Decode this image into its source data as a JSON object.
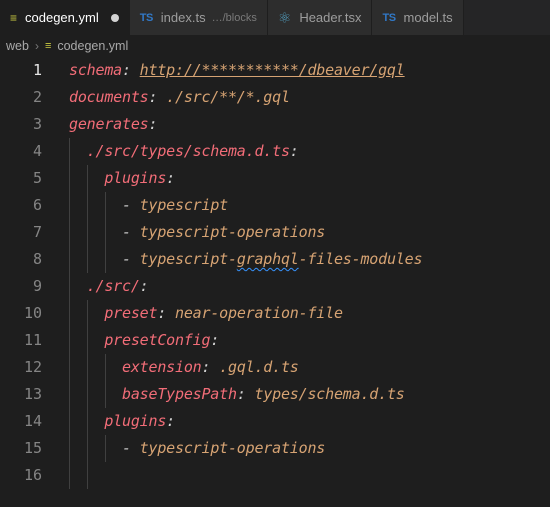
{
  "tabs": [
    {
      "label": "codegen.yml",
      "icon": "yaml-file-icon",
      "dirty": true,
      "active": true
    },
    {
      "label": "index.ts",
      "description": "…/blocks",
      "icon": "typescript-file-icon"
    },
    {
      "label": "Header.tsx",
      "icon": "react-file-icon"
    },
    {
      "label": "model.ts",
      "icon": "typescript-file-icon"
    }
  ],
  "icons": {
    "ts_glyph": "TS",
    "yml_glyph": "≡",
    "react_glyph": "⚛",
    "chevron": "›"
  },
  "breadcrumb": {
    "folder": "web",
    "file": "codegen.yml"
  },
  "lines": [
    {
      "n": "1",
      "t": [
        [
          "k",
          "schema"
        ],
        [
          "p",
          ": "
        ],
        [
          "v u",
          "http://***********/dbeaver/gql"
        ]
      ]
    },
    {
      "n": "2",
      "t": [
        [
          "k",
          "documents"
        ],
        [
          "p",
          ": "
        ],
        [
          "v",
          "./src/**/*.gql"
        ]
      ]
    },
    {
      "n": "3",
      "t": [
        [
          "k",
          "generates"
        ],
        [
          "p",
          ":"
        ]
      ]
    },
    {
      "n": "4",
      "t": [
        [
          "p",
          "  "
        ],
        [
          "k",
          "./src/types/schema.d.ts"
        ],
        [
          "p",
          ":"
        ]
      ]
    },
    {
      "n": "5",
      "t": [
        [
          "p",
          "    "
        ],
        [
          "k",
          "plugins"
        ],
        [
          "p",
          ":"
        ]
      ]
    },
    {
      "n": "6",
      "t": [
        [
          "p",
          "      "
        ],
        [
          "d",
          "- "
        ],
        [
          "v",
          "typescript"
        ]
      ]
    },
    {
      "n": "7",
      "t": [
        [
          "p",
          "      "
        ],
        [
          "d",
          "- "
        ],
        [
          "v",
          "typescript-operations"
        ]
      ]
    },
    {
      "n": "8",
      "t": [
        [
          "p",
          "      "
        ],
        [
          "d",
          "- "
        ],
        [
          "v",
          "typescript-"
        ],
        [
          "v squig",
          "graphql"
        ],
        [
          "v",
          "-files-modules"
        ]
      ]
    },
    {
      "n": "9",
      "t": [
        [
          "p",
          "  "
        ],
        [
          "k",
          "./src/"
        ],
        [
          "p",
          ":"
        ]
      ]
    },
    {
      "n": "10",
      "t": [
        [
          "p",
          "    "
        ],
        [
          "k",
          "preset"
        ],
        [
          "p",
          ": "
        ],
        [
          "v",
          "near-operation-file"
        ]
      ]
    },
    {
      "n": "11",
      "t": [
        [
          "p",
          "    "
        ],
        [
          "k",
          "presetConfig"
        ],
        [
          "p",
          ":"
        ]
      ]
    },
    {
      "n": "12",
      "t": [
        [
          "p",
          "      "
        ],
        [
          "k",
          "extension"
        ],
        [
          "p",
          ": "
        ],
        [
          "v",
          ".gql.d.ts"
        ]
      ]
    },
    {
      "n": "13",
      "t": [
        [
          "p",
          "      "
        ],
        [
          "k",
          "baseTypesPath"
        ],
        [
          "p",
          ": "
        ],
        [
          "v",
          "types/schema.d.ts"
        ]
      ]
    },
    {
      "n": "14",
      "t": [
        [
          "p",
          "    "
        ],
        [
          "k",
          "plugins"
        ],
        [
          "p",
          ":"
        ]
      ]
    },
    {
      "n": "15",
      "t": [
        [
          "p",
          "      "
        ],
        [
          "d",
          "- "
        ],
        [
          "v",
          "typescript-operations"
        ]
      ]
    },
    {
      "n": "16",
      "t": []
    }
  ],
  "active_line": "1"
}
